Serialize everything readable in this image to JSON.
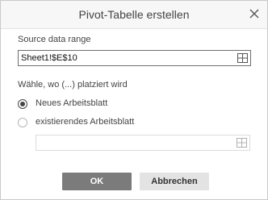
{
  "dialog": {
    "title": "Pivot-Tabelle erstellen",
    "close_icon": "close-icon"
  },
  "source": {
    "label": "Source data range",
    "value": "Sheet1!$E$10",
    "select_icon": "table-grid-icon"
  },
  "destination": {
    "label": "Wähle, wo (...) platziert wird",
    "options": [
      {
        "label": "Neues Arbeitsblatt",
        "checked": true
      },
      {
        "label": "existierendes Arbeitsblatt",
        "checked": false
      }
    ],
    "range_value": "",
    "select_icon": "table-grid-icon"
  },
  "buttons": {
    "ok": "OK",
    "cancel": "Abbrechen"
  },
  "colors": {
    "primary_button": "#7b7b7b",
    "secondary_button": "#e3e3e3"
  }
}
